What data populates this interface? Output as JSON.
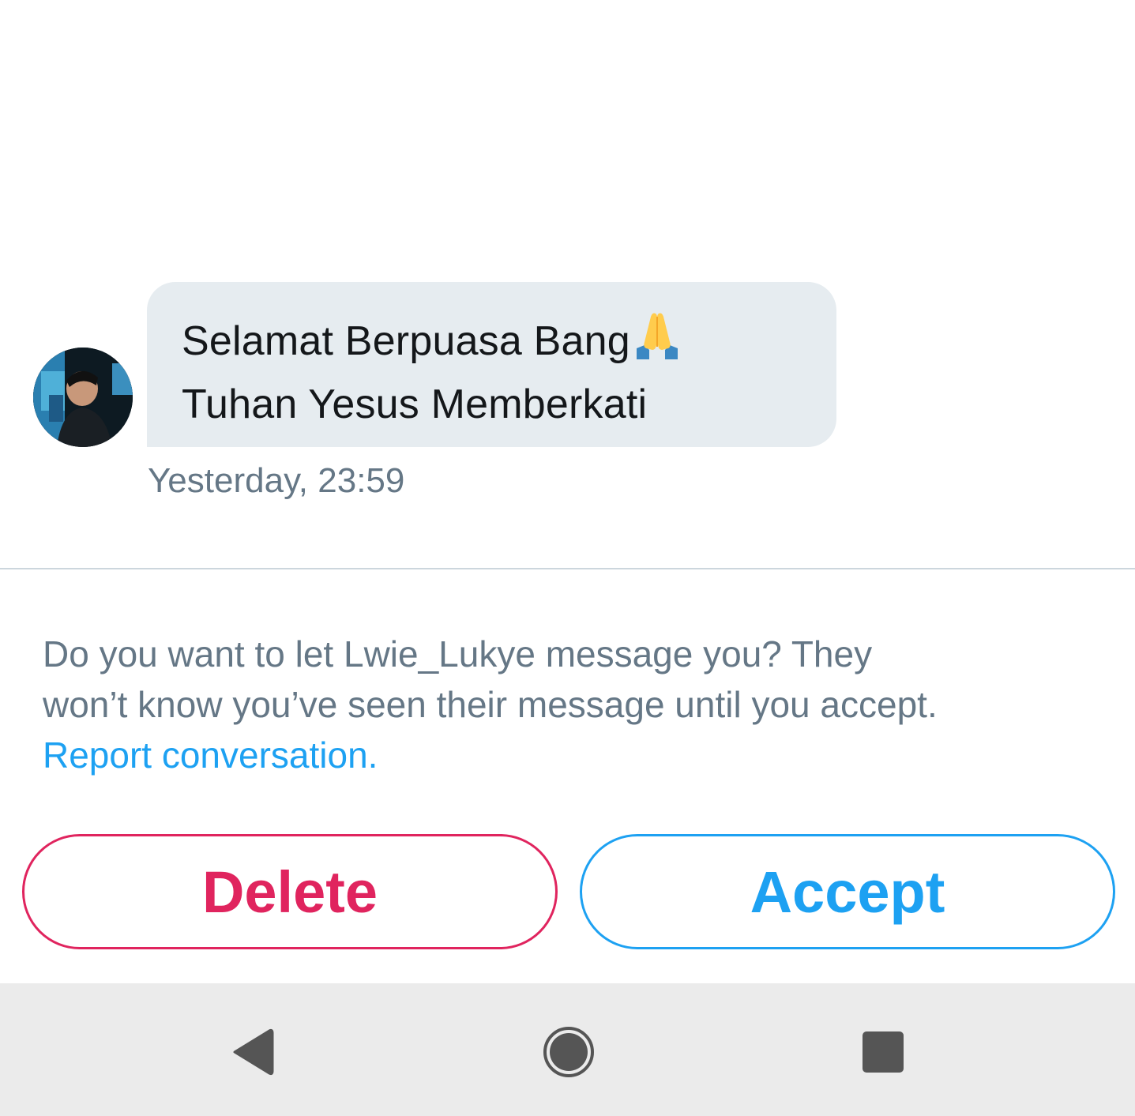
{
  "conversation": {
    "message": {
      "lines": [
        "Selamat Berpuasa Bang",
        "Tuhan Yesus Memberkati"
      ],
      "emoji_icon": "folded-hands-emoji",
      "timestamp": "Yesterday, 23:59"
    },
    "avatar_icon": "user-avatar"
  },
  "request": {
    "line1": "Do you want to let Lwie_Lukye message you? They",
    "line2": "won’t know you’ve seen their message until you accept.",
    "report_link": "Report conversation."
  },
  "actions": {
    "delete_label": "Delete",
    "accept_label": "Accept"
  },
  "navbar": {
    "back_icon": "back-triangle-icon",
    "home_icon": "home-circle-icon",
    "recents_icon": "recents-square-icon"
  },
  "colors": {
    "bubble": "#e6ecf0",
    "secondary_text": "#657786",
    "link": "#1da1f2",
    "delete": "#e0245e",
    "accept": "#1da1f2",
    "navbar": "#ebebeb"
  }
}
